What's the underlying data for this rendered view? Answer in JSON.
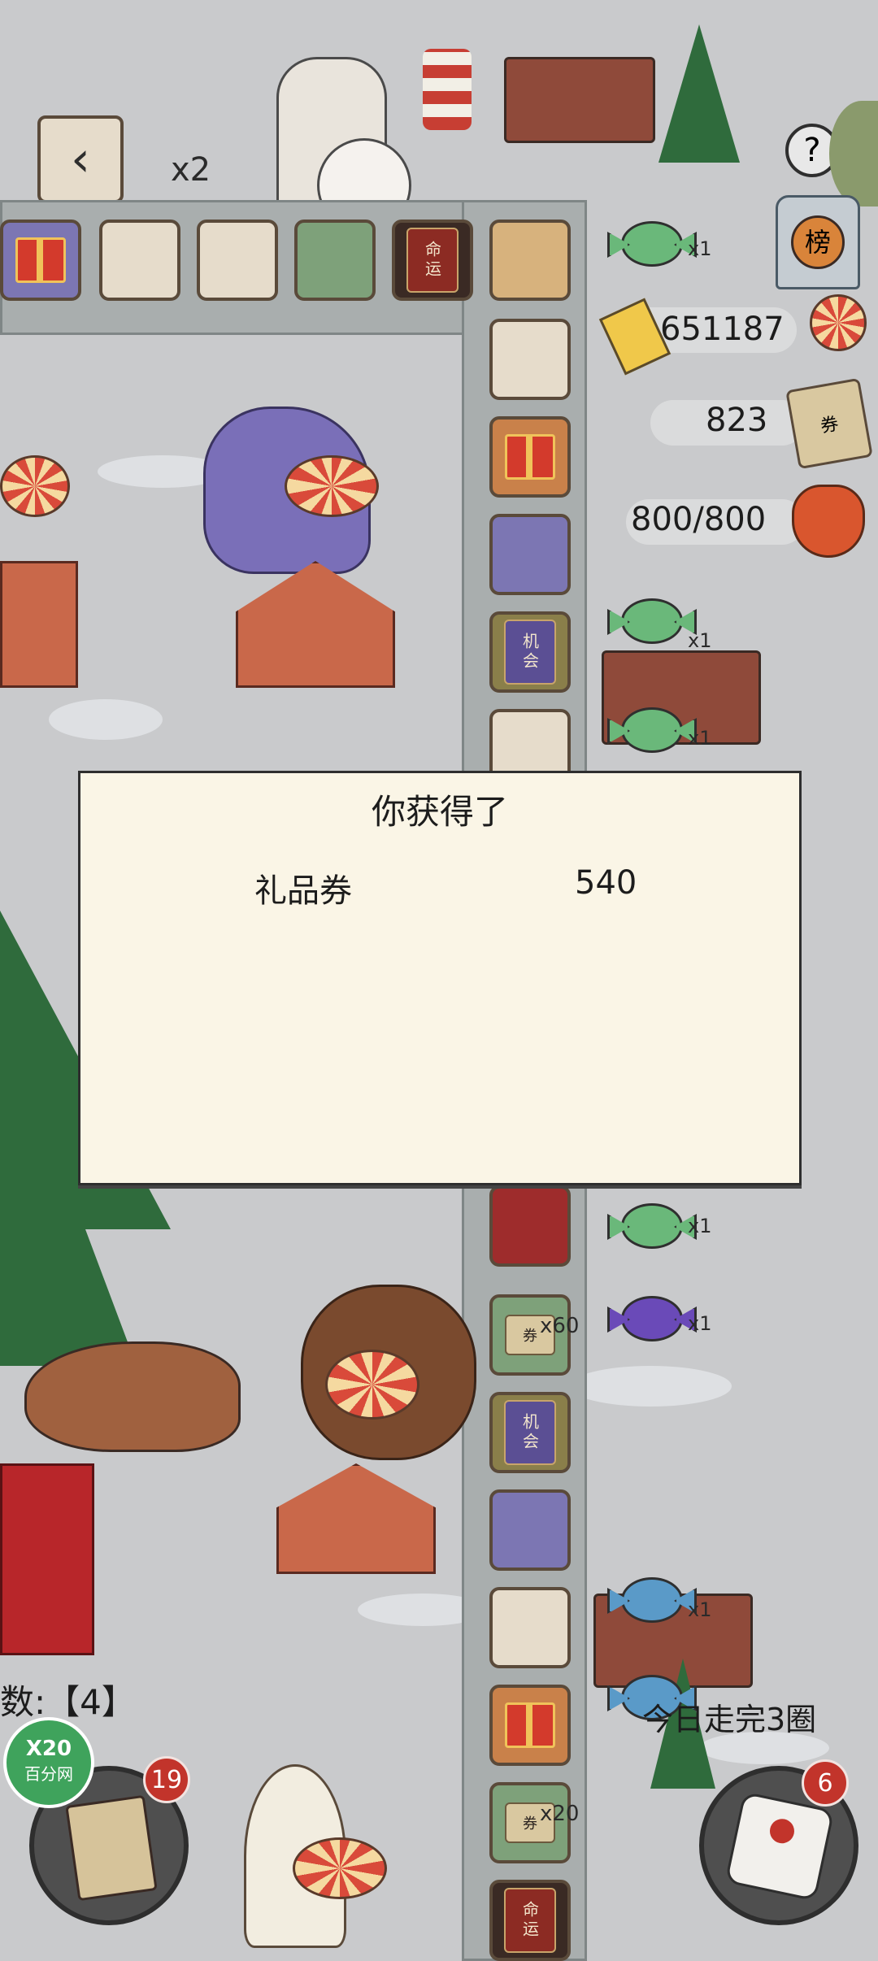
{
  "top_bar": {
    "multiplier": "x2",
    "help_label": "?",
    "rank_label": "榜"
  },
  "board": {
    "book_fate": "命运",
    "book_chance": "机会",
    "coupon_icon_label": "券",
    "tile_count_60": "x60",
    "tile_count_20": "x20"
  },
  "resources": {
    "candy_currency": "651187",
    "coupons": "823",
    "stamina": "800/800"
  },
  "side_counts": [
    "x1",
    "x1",
    "x1",
    "x1",
    "x1",
    "x1",
    "x1",
    "x1"
  ],
  "dialog": {
    "title": "你获得了",
    "reward_name": "礼品券",
    "reward_value": "540"
  },
  "bottom": {
    "dice_count_text": "数:【4】",
    "goal_text": "今日走完3圈",
    "cards_badge": "19",
    "dice_badge": "6",
    "watermark_top": "X20",
    "watermark_bottom": "百分网"
  },
  "colors": {
    "dialog_bg": "#faf5e6",
    "badge_red": "#c2342b",
    "background_gray": "#c9cacc"
  }
}
